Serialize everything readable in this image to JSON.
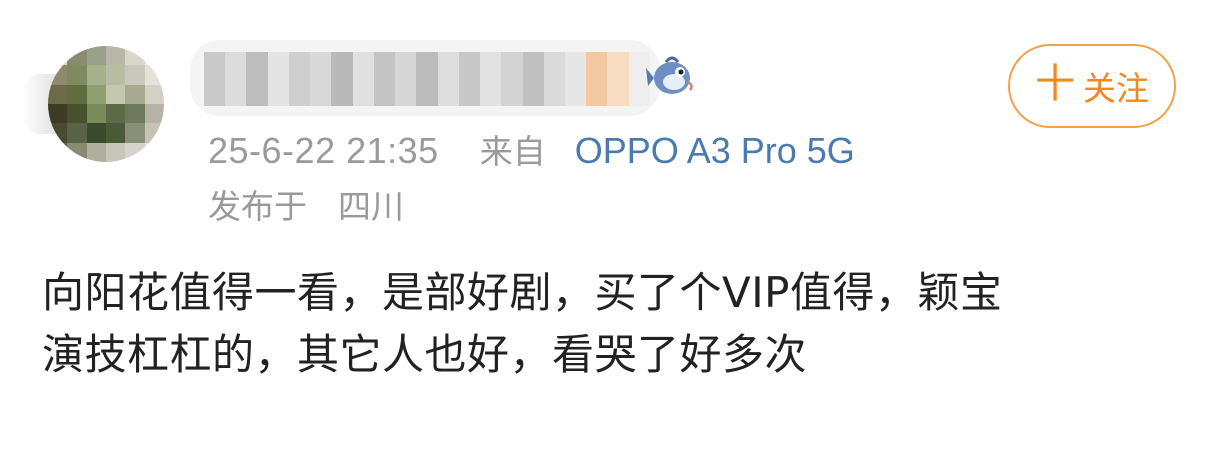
{
  "post": {
    "timestamp": "25-6-22 21:35",
    "source_prefix": "来自",
    "source_device": "OPPO A3 Pro 5G",
    "location_label": "发布于",
    "location_value": "四川",
    "body_lines": [
      "向阳花值得一看，是部好剧，买了个VIP值得，颖宝",
      "演技杠杠的，其它人也好，看哭了好多次"
    ]
  },
  "follow_button": {
    "plus_glyph": "十",
    "label": "关注"
  },
  "colors": {
    "accent_orange": "#f08a1c",
    "link_blue": "#4a7ab0",
    "meta_gray": "#9a9a9a",
    "body_text": "#222222"
  },
  "icons": {
    "badge": "fish-mascot-icon"
  }
}
